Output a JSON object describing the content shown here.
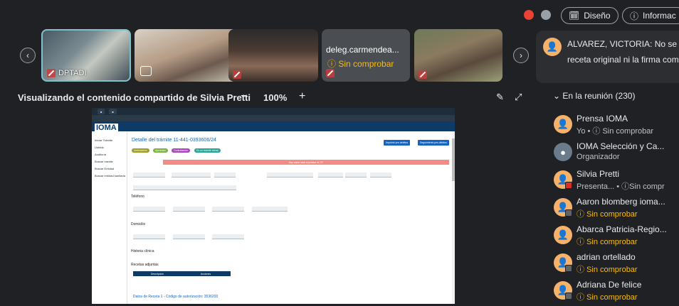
{
  "filmstrip": {
    "tiles": [
      {
        "name": "DPTADI"
      },
      {
        "name": ""
      },
      {
        "name": ""
      },
      {
        "name": "deleg.carmendea...",
        "status": "Sin comprobar"
      },
      {
        "name": ""
      }
    ]
  },
  "share": {
    "title": "Visualizando el contenido compartido de Silvia Pretti",
    "zoom": "100%",
    "zoom_minus": "−",
    "zoom_plus": "+"
  },
  "header_buttons": {
    "design": "Diseño",
    "info": "Informac"
  },
  "chat": {
    "sender": "ALVAREZ, VICTORIA: No se",
    "line2": "receta original ni la firma come"
  },
  "participants": {
    "section": "En la reunión (230)",
    "items": [
      {
        "name": "Prensa IOMA",
        "status": "Yo  •  ⓘ Sin comprobar"
      },
      {
        "name": "IOMA Selección y Ca...",
        "status": "Organizador"
      },
      {
        "name": "Silvia Pretti",
        "status": "Presenta...  • ⓘSin compr"
      },
      {
        "name": "Aaron blomberg ioma...",
        "status": "ⓘ Sin comprobar"
      },
      {
        "name": "Abarca Patricia-Regio...",
        "status": "ⓘ Sin comprobar"
      },
      {
        "name": "adrian ortellado",
        "status": "ⓘ Sin comprobar"
      },
      {
        "name": "Adriana De felice",
        "status": "ⓘ Sin comprobar"
      }
    ]
  },
  "browser": {
    "logo": "IOMA",
    "title": "Detalle del trámite 11-441-0393606/24",
    "pills": [
      "Ambulatorio",
      "Aprobado",
      "Contratación",
      "En un trámite inicial"
    ],
    "alert": "Hay saldo total al prestar el 70°",
    "buttons": [
      "Imprimir pre-debitos",
      "Seguimiento pre-débitos"
    ],
    "sections": [
      "Teléfono",
      "Domicilio",
      "Historia clínica",
      "Recetas adjuntas"
    ],
    "table_headers": [
      "Descripción",
      "Acciones"
    ],
    "footer_link": "Datos de Receta 1 - Código de autorización: 3536200",
    "sidebar": [
      "Iniciar Trámite",
      "Listado",
      "Auditoría",
      "Buscar trámite",
      "Buscar Entidad",
      "Buscar entidad sanitaria"
    ]
  }
}
